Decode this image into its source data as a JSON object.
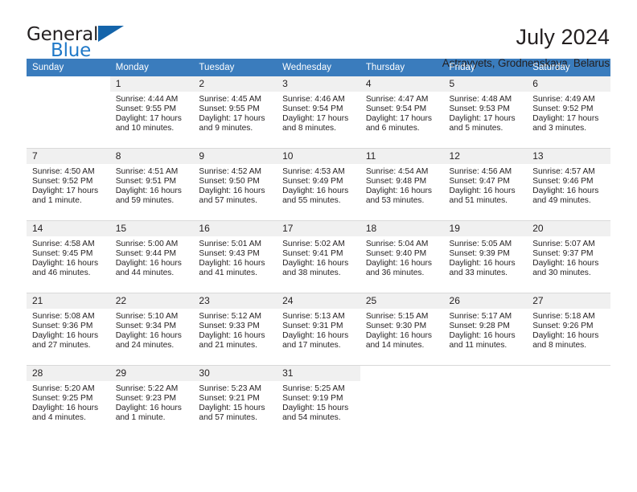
{
  "logo": {
    "word_one": "General",
    "word_two": "Blue",
    "triangle_color": "#1464aa",
    "blue_color": "#2079c8"
  },
  "header": {
    "title": "July 2024",
    "subtitle": "Astravyets, Grodnenskaya, Belarus"
  },
  "calendar": {
    "header_color": "#3a7cbd",
    "daynum_bg": "#f0f0f0",
    "weekdays": [
      "Sunday",
      "Monday",
      "Tuesday",
      "Wednesday",
      "Thursday",
      "Friday",
      "Saturday"
    ],
    "weeks": [
      [
        {
          "day": "",
          "lines": []
        },
        {
          "day": "1",
          "lines": [
            "Sunrise: 4:44 AM",
            "Sunset: 9:55 PM",
            "Daylight: 17 hours",
            "and 10 minutes."
          ]
        },
        {
          "day": "2",
          "lines": [
            "Sunrise: 4:45 AM",
            "Sunset: 9:55 PM",
            "Daylight: 17 hours",
            "and 9 minutes."
          ]
        },
        {
          "day": "3",
          "lines": [
            "Sunrise: 4:46 AM",
            "Sunset: 9:54 PM",
            "Daylight: 17 hours",
            "and 8 minutes."
          ]
        },
        {
          "day": "4",
          "lines": [
            "Sunrise: 4:47 AM",
            "Sunset: 9:54 PM",
            "Daylight: 17 hours",
            "and 6 minutes."
          ]
        },
        {
          "day": "5",
          "lines": [
            "Sunrise: 4:48 AM",
            "Sunset: 9:53 PM",
            "Daylight: 17 hours",
            "and 5 minutes."
          ]
        },
        {
          "day": "6",
          "lines": [
            "Sunrise: 4:49 AM",
            "Sunset: 9:52 PM",
            "Daylight: 17 hours",
            "and 3 minutes."
          ]
        }
      ],
      [
        {
          "day": "7",
          "lines": [
            "Sunrise: 4:50 AM",
            "Sunset: 9:52 PM",
            "Daylight: 17 hours",
            "and 1 minute."
          ]
        },
        {
          "day": "8",
          "lines": [
            "Sunrise: 4:51 AM",
            "Sunset: 9:51 PM",
            "Daylight: 16 hours",
            "and 59 minutes."
          ]
        },
        {
          "day": "9",
          "lines": [
            "Sunrise: 4:52 AM",
            "Sunset: 9:50 PM",
            "Daylight: 16 hours",
            "and 57 minutes."
          ]
        },
        {
          "day": "10",
          "lines": [
            "Sunrise: 4:53 AM",
            "Sunset: 9:49 PM",
            "Daylight: 16 hours",
            "and 55 minutes."
          ]
        },
        {
          "day": "11",
          "lines": [
            "Sunrise: 4:54 AM",
            "Sunset: 9:48 PM",
            "Daylight: 16 hours",
            "and 53 minutes."
          ]
        },
        {
          "day": "12",
          "lines": [
            "Sunrise: 4:56 AM",
            "Sunset: 9:47 PM",
            "Daylight: 16 hours",
            "and 51 minutes."
          ]
        },
        {
          "day": "13",
          "lines": [
            "Sunrise: 4:57 AM",
            "Sunset: 9:46 PM",
            "Daylight: 16 hours",
            "and 49 minutes."
          ]
        }
      ],
      [
        {
          "day": "14",
          "lines": [
            "Sunrise: 4:58 AM",
            "Sunset: 9:45 PM",
            "Daylight: 16 hours",
            "and 46 minutes."
          ]
        },
        {
          "day": "15",
          "lines": [
            "Sunrise: 5:00 AM",
            "Sunset: 9:44 PM",
            "Daylight: 16 hours",
            "and 44 minutes."
          ]
        },
        {
          "day": "16",
          "lines": [
            "Sunrise: 5:01 AM",
            "Sunset: 9:43 PM",
            "Daylight: 16 hours",
            "and 41 minutes."
          ]
        },
        {
          "day": "17",
          "lines": [
            "Sunrise: 5:02 AM",
            "Sunset: 9:41 PM",
            "Daylight: 16 hours",
            "and 38 minutes."
          ]
        },
        {
          "day": "18",
          "lines": [
            "Sunrise: 5:04 AM",
            "Sunset: 9:40 PM",
            "Daylight: 16 hours",
            "and 36 minutes."
          ]
        },
        {
          "day": "19",
          "lines": [
            "Sunrise: 5:05 AM",
            "Sunset: 9:39 PM",
            "Daylight: 16 hours",
            "and 33 minutes."
          ]
        },
        {
          "day": "20",
          "lines": [
            "Sunrise: 5:07 AM",
            "Sunset: 9:37 PM",
            "Daylight: 16 hours",
            "and 30 minutes."
          ]
        }
      ],
      [
        {
          "day": "21",
          "lines": [
            "Sunrise: 5:08 AM",
            "Sunset: 9:36 PM",
            "Daylight: 16 hours",
            "and 27 minutes."
          ]
        },
        {
          "day": "22",
          "lines": [
            "Sunrise: 5:10 AM",
            "Sunset: 9:34 PM",
            "Daylight: 16 hours",
            "and 24 minutes."
          ]
        },
        {
          "day": "23",
          "lines": [
            "Sunrise: 5:12 AM",
            "Sunset: 9:33 PM",
            "Daylight: 16 hours",
            "and 21 minutes."
          ]
        },
        {
          "day": "24",
          "lines": [
            "Sunrise: 5:13 AM",
            "Sunset: 9:31 PM",
            "Daylight: 16 hours",
            "and 17 minutes."
          ]
        },
        {
          "day": "25",
          "lines": [
            "Sunrise: 5:15 AM",
            "Sunset: 9:30 PM",
            "Daylight: 16 hours",
            "and 14 minutes."
          ]
        },
        {
          "day": "26",
          "lines": [
            "Sunrise: 5:17 AM",
            "Sunset: 9:28 PM",
            "Daylight: 16 hours",
            "and 11 minutes."
          ]
        },
        {
          "day": "27",
          "lines": [
            "Sunrise: 5:18 AM",
            "Sunset: 9:26 PM",
            "Daylight: 16 hours",
            "and 8 minutes."
          ]
        }
      ],
      [
        {
          "day": "28",
          "lines": [
            "Sunrise: 5:20 AM",
            "Sunset: 9:25 PM",
            "Daylight: 16 hours",
            "and 4 minutes."
          ]
        },
        {
          "day": "29",
          "lines": [
            "Sunrise: 5:22 AM",
            "Sunset: 9:23 PM",
            "Daylight: 16 hours",
            "and 1 minute."
          ]
        },
        {
          "day": "30",
          "lines": [
            "Sunrise: 5:23 AM",
            "Sunset: 9:21 PM",
            "Daylight: 15 hours",
            "and 57 minutes."
          ]
        },
        {
          "day": "31",
          "lines": [
            "Sunrise: 5:25 AM",
            "Sunset: 9:19 PM",
            "Daylight: 15 hours",
            "and 54 minutes."
          ]
        },
        {
          "day": "",
          "lines": []
        },
        {
          "day": "",
          "lines": []
        },
        {
          "day": "",
          "lines": []
        }
      ]
    ]
  }
}
